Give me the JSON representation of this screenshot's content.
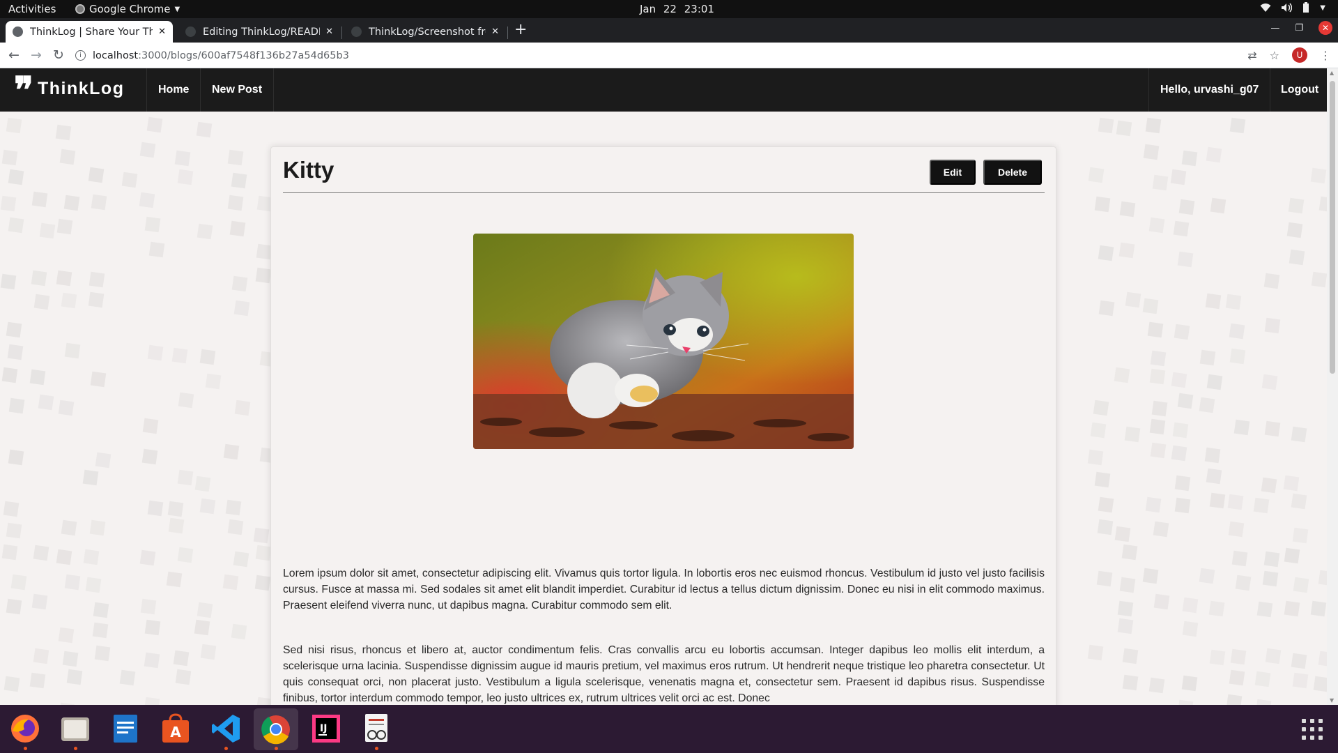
{
  "topbar": {
    "activities": "Activities",
    "app_name": "Google Chrome",
    "datetime": "Jan 22  23:01"
  },
  "tabs": [
    {
      "title": "ThinkLog | Share Your Thoughts",
      "active": true
    },
    {
      "title": "Editing ThinkLog/README.md",
      "active": false
    },
    {
      "title": "ThinkLog/Screenshot from",
      "active": false
    }
  ],
  "address_bar": {
    "host": "localhost",
    "path": ":3000/blogs/600af7548f136b27a54d65b3"
  },
  "profile_initial": "U",
  "site": {
    "brand": "ThinkLog",
    "nav": {
      "home": "Home",
      "new_post": "New Post",
      "greeting": "Hello, urvashi_g07",
      "logout": "Logout"
    }
  },
  "post": {
    "title": "Kitty",
    "edit_label": "Edit",
    "delete_label": "Delete",
    "image_subject": "kitten-photo",
    "paragraphs": [
      "Lorem ipsum dolor sit amet, consectetur adipiscing elit. Vivamus quis tortor ligula. In lobortis eros nec euismod rhoncus. Vestibulum id justo vel justo facilisis cursus. Fusce at massa mi. Sed sodales sit amet elit blandit imperdiet. Curabitur id lectus a tellus dictum dignissim. Donec eu nisi in elit commodo maximus. Praesent eleifend viverra nunc, ut dapibus magna. Curabitur commodo sem elit.",
      "Sed nisi risus, rhoncus et libero at, auctor condimentum felis. Cras convallis arcu eu lobortis accumsan. Integer dapibus leo mollis elit interdum, a scelerisque urna lacinia. Suspendisse dignissim augue id mauris pretium, vel maximus eros rutrum. Ut hendrerit neque tristique leo pharetra consectetur. Ut quis consequat orci, non placerat justo. Vestibulum a ligula scelerisque, venenatis magna et, consectetur sem. Praesent id dapibus risus. Suspendisse finibus, tortor interdum commodo tempor, leo justo ultrices ex, rutrum ultrices velit orci ac est. Donec"
    ]
  },
  "dock": {
    "apps": [
      "firefox-icon",
      "files-icon",
      "text-editor-icon",
      "software-center-icon",
      "vscode-icon",
      "chrome-icon",
      "intellij-icon",
      "document-viewer-icon"
    ],
    "show_apps": "apps-grid-icon"
  },
  "colors": {
    "navbar": "#1b1b1b",
    "page_bg": "#f5f2f1",
    "button": "#121212",
    "dock": "#2c1a33",
    "ubuntu_orange": "#e95420"
  }
}
